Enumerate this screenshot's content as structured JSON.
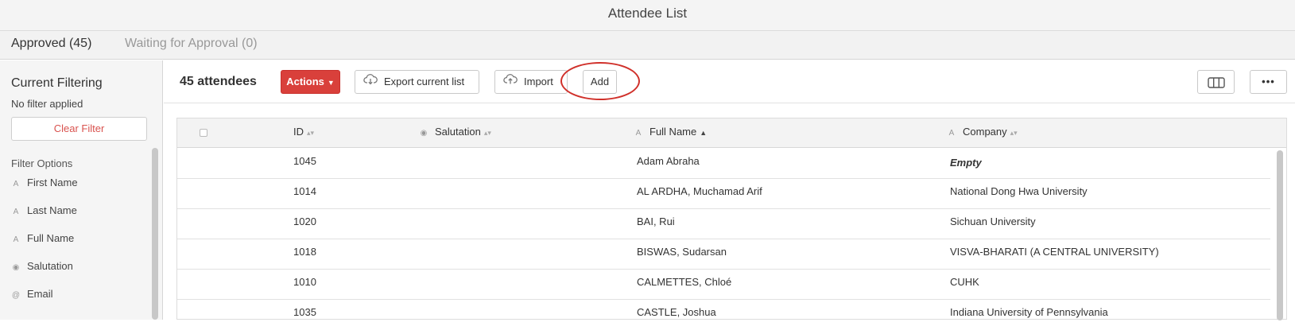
{
  "window": {
    "title": "Attendee List"
  },
  "tabs": [
    {
      "label": "Approved (45)",
      "active": true
    },
    {
      "label": "Waiting for Approval (0)",
      "active": false
    }
  ],
  "sidebar": {
    "title": "Current Filtering",
    "status": "No filter applied",
    "clear_label": "Clear Filter",
    "options_title": "Filter Options",
    "filters": [
      {
        "label": "First Name",
        "icon": "text-field-icon"
      },
      {
        "label": "Last Name",
        "icon": "text-field-icon"
      },
      {
        "label": "Full Name",
        "icon": "text-field-icon"
      },
      {
        "label": "Salutation",
        "icon": "radio-field-icon"
      },
      {
        "label": "Email",
        "icon": "email-field-icon"
      }
    ]
  },
  "toolbar": {
    "count_label": "45 attendees",
    "actions_label": "Actions",
    "export_label": "Export current list",
    "import_label": "Import",
    "add_label": "Add",
    "accent_color": "#d9403b",
    "highlight_color": "#d0302a"
  },
  "table": {
    "columns": [
      {
        "label": "ID",
        "sort": "none"
      },
      {
        "label": "Salutation",
        "sort": "none",
        "icon": "radio-field-icon"
      },
      {
        "label": "Full Name",
        "sort": "asc",
        "icon": "text-field-icon"
      },
      {
        "label": "Company",
        "sort": "none",
        "icon": "text-field-icon"
      }
    ],
    "rows": [
      {
        "id": "1045",
        "salutation": "",
        "full_name": "Adam Abraha",
        "company": "Empty"
      },
      {
        "id": "1014",
        "salutation": "",
        "full_name": "AL ARDHA, Muchamad Arif",
        "company": "National Dong Hwa University"
      },
      {
        "id": "1020",
        "salutation": "",
        "full_name": "BAI, Rui",
        "company": "Sichuan University"
      },
      {
        "id": "1018",
        "salutation": "",
        "full_name": "BISWAS, Sudarsan",
        "company": "VISVA-BHARATI (A CENTRAL UNIVERSITY)"
      },
      {
        "id": "1010",
        "salutation": "",
        "full_name": "CALMETTES, Chloé",
        "company": "CUHK"
      },
      {
        "id": "1035",
        "salutation": "",
        "full_name": "CASTLE, Joshua",
        "company": "Indiana University of Pennsylvania"
      }
    ]
  }
}
